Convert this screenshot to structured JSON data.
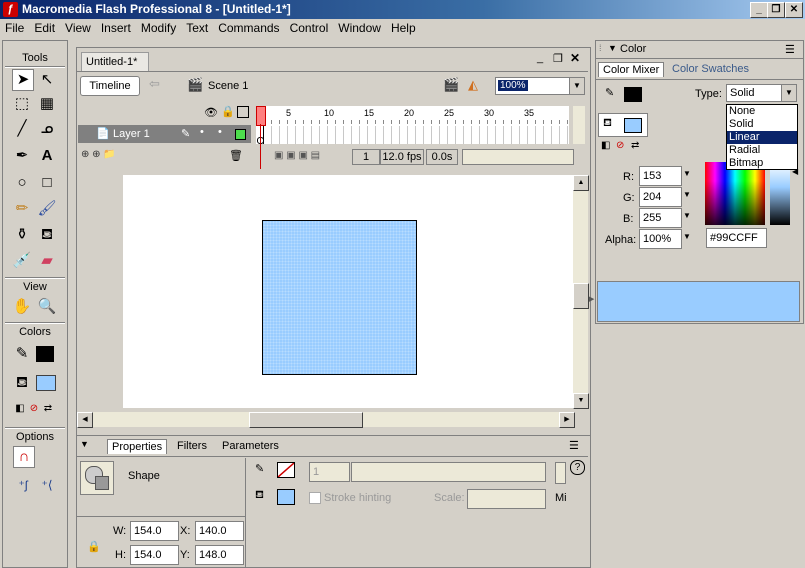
{
  "app": {
    "title": "Macromedia Flash Professional 8 - [Untitled-1*]",
    "window_buttons": [
      "_",
      "ð",
      "X"
    ]
  },
  "menu": [
    "File",
    "Edit",
    "View",
    "Insert",
    "Modify",
    "Text",
    "Commands",
    "Control",
    "Window",
    "Help"
  ],
  "tools": {
    "title": "Tools",
    "view_label": "View",
    "colors_label": "Colors",
    "options_label": "Options",
    "stroke_color": "#000000",
    "fill_color": "#99ccff"
  },
  "document": {
    "tab": "Untitled-1*",
    "timeline_button": "Timeline",
    "scene": "Scene 1",
    "zoom": "100%",
    "layer_name": "Layer 1",
    "ruler": [
      "1",
      "5",
      "10",
      "15",
      "20",
      "25",
      "30",
      "35"
    ],
    "frame_number": "1",
    "fps": "12.0 fps",
    "time": "0.0s",
    "shape_fill": "#99ccff"
  },
  "properties": {
    "tabs": [
      "Properties",
      "Filters",
      "Parameters"
    ],
    "shape_label": "Shape",
    "stroke_height": "1",
    "stroke_hinting": "Stroke hinting",
    "scale_label": "Scale:",
    "mi_label": "Mi",
    "w_label": "W:",
    "w_value": "154.0",
    "h_label": "H:",
    "h_value": "154.0",
    "x_label": "X:",
    "x_value": "140.0",
    "y_label": "Y:",
    "y_value": "148.0"
  },
  "color_panel": {
    "title": "Color",
    "tabs": [
      "Color Mixer",
      "Color Swatches"
    ],
    "type_label": "Type:",
    "type_value": "Solid",
    "type_options": [
      "None",
      "Solid",
      "Linear",
      "Radial",
      "Bitmap"
    ],
    "highlighted_option": "Linear",
    "r_label": "R:",
    "r_value": "153",
    "g_label": "G:",
    "g_value": "204",
    "b_label": "B:",
    "b_value": "255",
    "alpha_label": "Alpha:",
    "alpha_value": "100%",
    "hex_value": "#99CCFF",
    "preview_color": "#99ccff"
  }
}
